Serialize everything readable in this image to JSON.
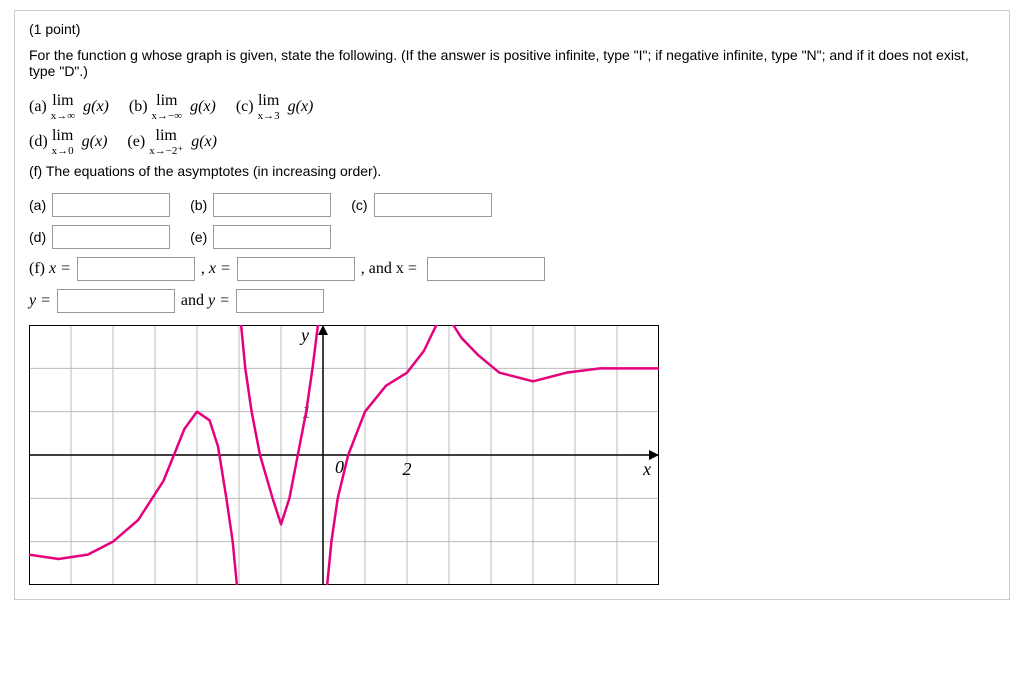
{
  "header": {
    "points": "(1 point)",
    "instructions": "For the function g whose graph is given, state the following. (If the answer is positive infinite, type \"I\"; if negative infinite, type \"N\"; and if it does not exist, type \"D\".)"
  },
  "limits": {
    "row1": [
      {
        "tag": "(a)",
        "lim": "lim",
        "sub": "x→∞",
        "fn": " g(x)"
      },
      {
        "tag": "(b)",
        "lim": "lim",
        "sub": "x→−∞",
        "fn": " g(x)"
      },
      {
        "tag": "(c)",
        "lim": "lim",
        "sub": "x→3",
        "fn": " g(x)"
      }
    ],
    "row2": [
      {
        "tag": "(d)",
        "lim": "lim",
        "sub": "x→0",
        "fn": " g(x)"
      },
      {
        "tag": "(e)",
        "lim": "lim",
        "sub": "x→−2⁺",
        "fn": " g(x)"
      }
    ],
    "f_label": "(f) The equations of the asymptotes (in increasing order)."
  },
  "answers": {
    "a_label": "(a)",
    "b_label": "(b)",
    "c_label": "(c)",
    "d_label": "(d)",
    "e_label": "(e)",
    "f_pre": "(f) ",
    "x_eq": "x =",
    "comma_x_eq": ", x =",
    "and_x_eq": ", and x =",
    "y_eq": "y =",
    "and_y_eq": "and y ="
  },
  "chart_data": {
    "type": "line",
    "title": "",
    "xlabel": "x",
    "ylabel": "y",
    "xlim": [
      -7,
      8
    ],
    "ylim": [
      -3,
      3
    ],
    "grid": true,
    "ticks": {
      "x_shown": [
        0,
        2
      ],
      "y_shown": [
        0,
        1
      ]
    },
    "asymptotes": {
      "vertical_x": [
        -2,
        0,
        3
      ],
      "horizontal_y": [
        -2,
        2
      ]
    },
    "series": [
      {
        "name": "g",
        "color": "#e6007e",
        "segments": [
          {
            "comment": "left tail approaching y=-2 from below, rising toward x=-2-",
            "points": [
              [
                -7,
                -2.3
              ],
              [
                -6.3,
                -2.4
              ],
              [
                -5.6,
                -2.3
              ],
              [
                -5,
                -2.0
              ],
              [
                -4.4,
                -1.5
              ],
              [
                -3.8,
                -0.6
              ],
              [
                -3.3,
                0.6
              ],
              [
                -3,
                1.0
              ],
              [
                -2.7,
                0.8
              ],
              [
                -2.5,
                0.2
              ],
              [
                -2.3,
                -1
              ],
              [
                -2.15,
                -2
              ],
              [
                -2.05,
                -3
              ]
            ]
          },
          {
            "comment": "between x=-2 and x=0, down from +∞ then back up to +∞",
            "points": [
              [
                -1.95,
                3
              ],
              [
                -1.85,
                2
              ],
              [
                -1.7,
                1
              ],
              [
                -1.5,
                0
              ],
              [
                -1.2,
                -1
              ],
              [
                -1,
                -1.6
              ],
              [
                -0.8,
                -1
              ],
              [
                -0.6,
                0
              ],
              [
                -0.4,
                1
              ],
              [
                -0.25,
                2
              ],
              [
                -0.12,
                3
              ]
            ]
          },
          {
            "comment": "between x=0 and x=3, up from -∞ over hump then up to +∞",
            "points": [
              [
                0.1,
                -3
              ],
              [
                0.2,
                -2
              ],
              [
                0.35,
                -1
              ],
              [
                0.6,
                0
              ],
              [
                1,
                1
              ],
              [
                1.5,
                1.6
              ],
              [
                2,
                1.9
              ],
              [
                2.4,
                2.4
              ],
              [
                2.7,
                3
              ]
            ]
          },
          {
            "comment": "right of x=3 down from +∞ toward y≈2",
            "points": [
              [
                3.1,
                3
              ],
              [
                3.3,
                2.7
              ],
              [
                3.7,
                2.3
              ],
              [
                4.2,
                1.9
              ],
              [
                5,
                1.7
              ],
              [
                5.8,
                1.9
              ],
              [
                6.6,
                2.0
              ],
              [
                7.5,
                2.0
              ],
              [
                8,
                2.0
              ]
            ]
          }
        ]
      }
    ]
  }
}
